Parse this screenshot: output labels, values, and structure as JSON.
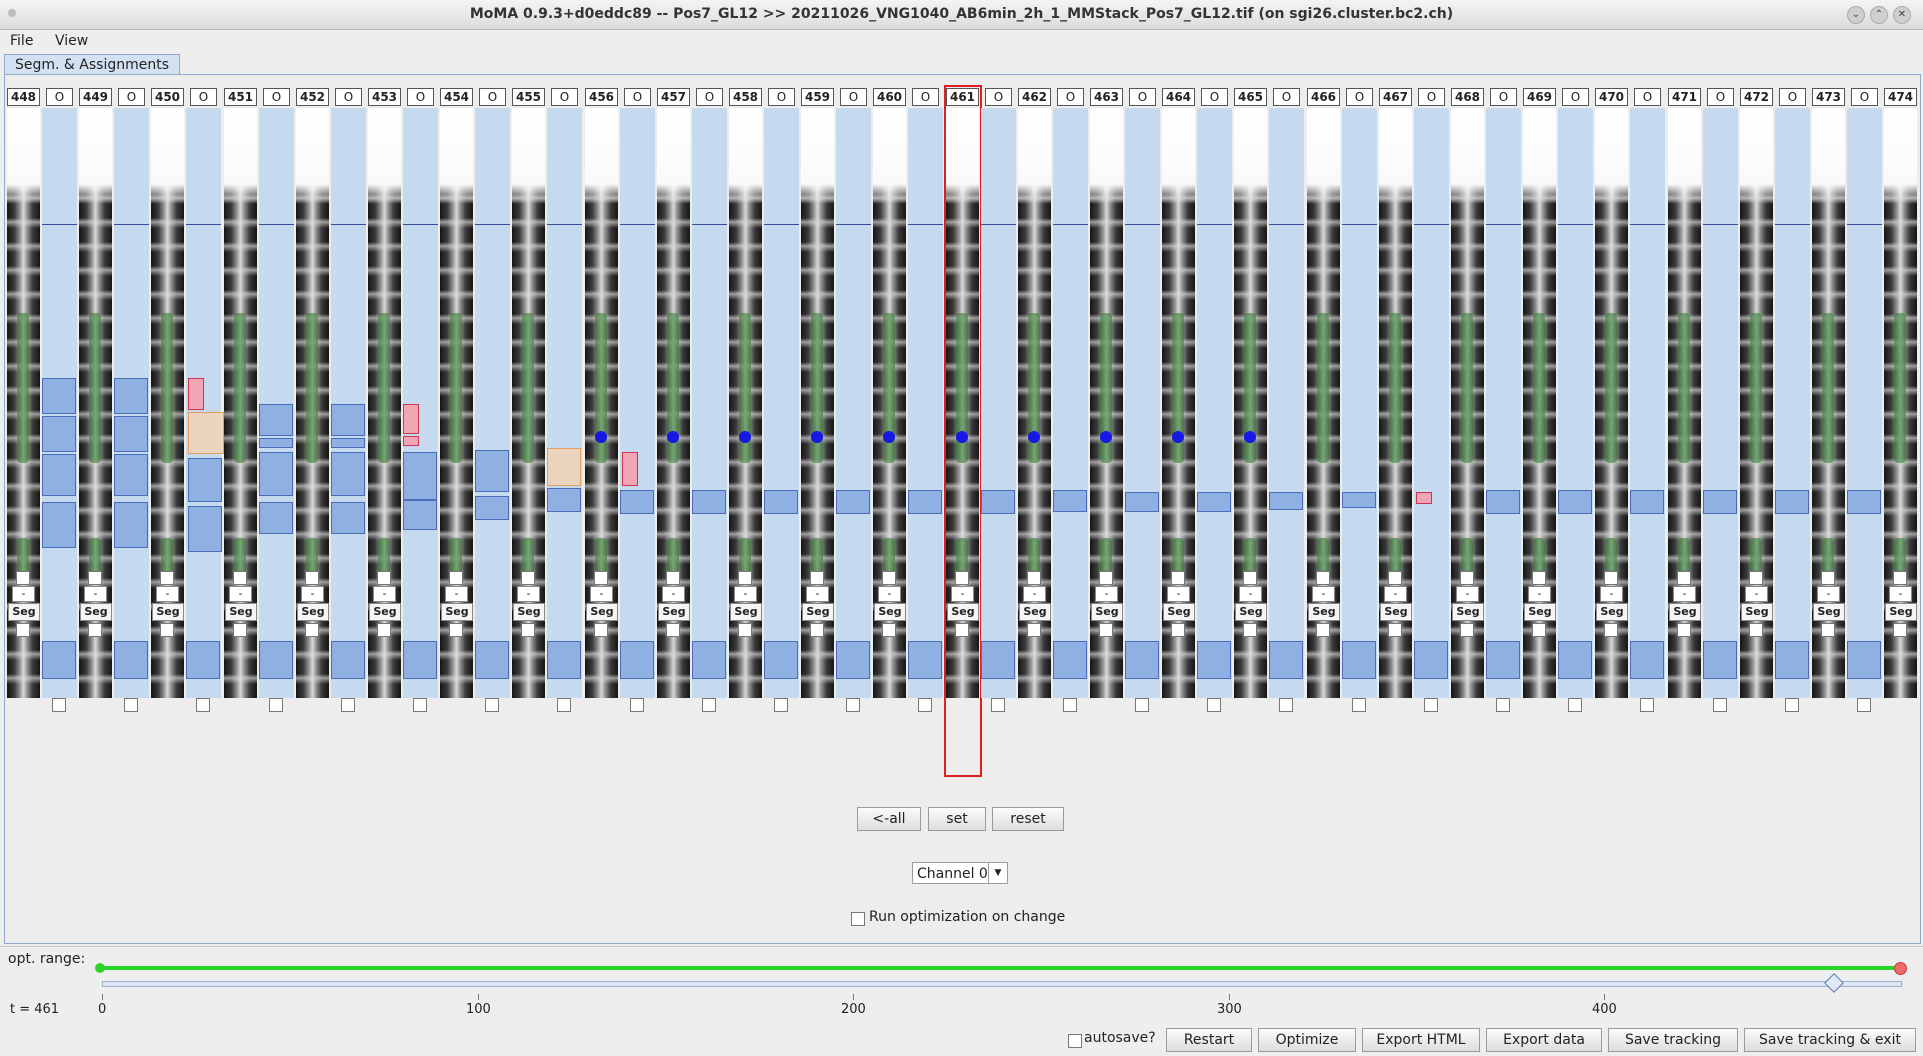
{
  "window": {
    "title": "MoMA 0.9.3+d0eddc89 -- Pos7_GL12 >> 20211026_VNG1040_AB6min_2h_1_MMStack_Pos7_GL12.tif (on sgi26.cluster.bc2.ch)"
  },
  "menu": {
    "file": "File",
    "view": "View"
  },
  "tab": {
    "label": "Segm. & Assignments"
  },
  "column_control": {
    "dash": "-",
    "seg": "Seg"
  },
  "gap_label": "O",
  "frames": [
    "448",
    "449",
    "450",
    "451",
    "452",
    "453",
    "454",
    "455",
    "456",
    "457",
    "458",
    "459",
    "460",
    "461",
    "462",
    "463",
    "464",
    "465",
    "466",
    "467",
    "468",
    "469",
    "470",
    "471",
    "472",
    "473",
    "474"
  ],
  "selected_frame": "461",
  "buttons": {
    "all": "<-all",
    "set": "set",
    "reset": "reset"
  },
  "channel": {
    "selected": "Channel 0"
  },
  "optimization": {
    "run_on_change": "Run optimization on change",
    "range_label": "opt. range:"
  },
  "time": {
    "label": "t =  461",
    "ticks": [
      "0",
      "100",
      "200",
      "300",
      "400"
    ]
  },
  "bottom": {
    "autosave": "autosave?",
    "restart": "Restart",
    "optimize": "Optimize",
    "export_html": "Export HTML",
    "export_data": "Export data",
    "save_tracking": "Save tracking",
    "save_exit": "Save tracking & exit"
  }
}
